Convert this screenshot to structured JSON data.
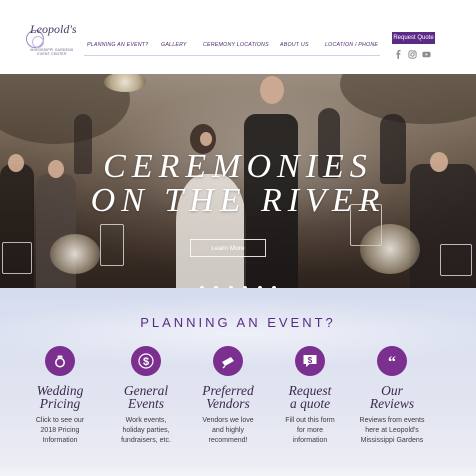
{
  "header": {
    "logo": {
      "script": "Leopold's",
      "subtitle": "MISSISSIPPI GARDENS EVENT CENTER"
    },
    "nav": [
      {
        "label": "PLANNING AN EVENT?"
      },
      {
        "label": "GALLERY"
      },
      {
        "label": "CEREMONY LOCATIONS"
      },
      {
        "label": "ABOUT US"
      },
      {
        "label": "LOCATION / PHONE"
      }
    ],
    "quote_button": "Request Quote",
    "social": [
      "facebook-icon",
      "instagram-icon",
      "youtube-icon"
    ],
    "brand_color": "#5b2a86"
  },
  "hero": {
    "title_line1": "CEREMONIES",
    "title_line2": "ON THE RIVER",
    "button": "Learn More",
    "slide_count": 6
  },
  "planning": {
    "title": "PLANNING AN EVENT?",
    "icon_color": "#7b2f8e",
    "cards": [
      {
        "icon": "ring-icon",
        "title_1": "Wedding",
        "title_2": "Pricing",
        "desc_1": "Click to see our",
        "desc_2": "2018 Pricing",
        "desc_3": "Information"
      },
      {
        "icon": "dollar-icon",
        "title_1": "General",
        "title_2": "Events",
        "desc_1": "Work events,",
        "desc_2": "holiday parties,",
        "desc_3": "fundraisers, etc."
      },
      {
        "icon": "pointer-icon",
        "title_1": "Preferred",
        "title_2": "Vendors",
        "desc_1": "Vendors we love",
        "desc_2": "and highly",
        "desc_3": "recommend!"
      },
      {
        "icon": "quote-dollar-icon",
        "title_1": "Request",
        "title_2": "a quote",
        "desc_1": "Fill out this form",
        "desc_2": "for more",
        "desc_3": "information"
      },
      {
        "icon": "quote-marks-icon",
        "title_1": "Our",
        "title_2": "Reviews",
        "desc_1": "Reviews from events",
        "desc_2": "here at Leopold's",
        "desc_3": "Mississippi Gardens"
      }
    ]
  }
}
